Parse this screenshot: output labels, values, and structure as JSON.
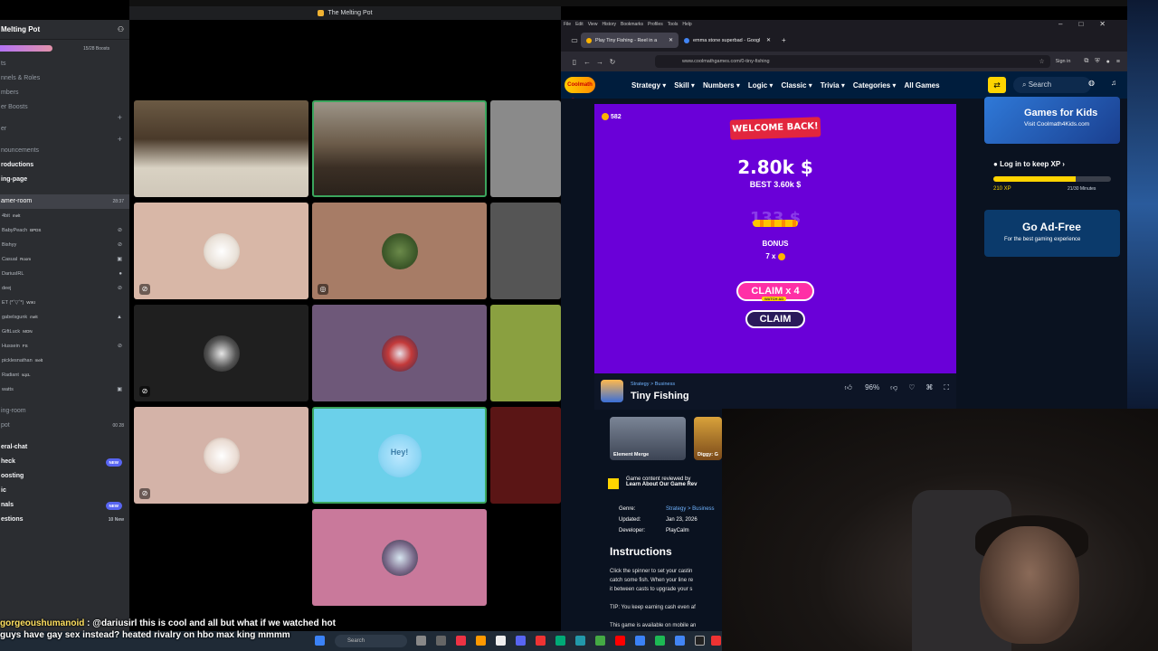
{
  "discord": {
    "server_name": "Melting Pot",
    "boosts": "15/28 Boosts",
    "channels_top": [
      "ts",
      "nnels & Roles",
      "mbers",
      "er Boosts"
    ],
    "text_channels": [
      "er",
      "",
      "nouncements",
      "roductions",
      "ing-page"
    ],
    "voice_channel": "amer-room",
    "voice_time": "28:37",
    "users": [
      {
        "name": "4bit",
        "tag": "melt"
      },
      {
        "name": "BabyPeach",
        "tag": "BPDS"
      },
      {
        "name": "Bishyy",
        "tag": ""
      },
      {
        "name": "Casual",
        "tag": "Room"
      },
      {
        "name": "DariusIRL",
        "tag": ""
      },
      {
        "name": "deej",
        "tag": ""
      },
      {
        "name": "ET (*ˆ▽ˆ*)",
        "tag": "WIKI"
      },
      {
        "name": "gabelsgunk",
        "tag": "melt"
      },
      {
        "name": "GiftLuck",
        "tag": "MON"
      },
      {
        "name": "Hussein",
        "tag": "FS"
      },
      {
        "name": "picklesnathan",
        "tag": "melt"
      },
      {
        "name": "Radiant",
        "tag": "sqcL"
      },
      {
        "name": "watts",
        "tag": ""
      }
    ],
    "bottom_channels": [
      {
        "label": "ing-room",
        "right": ""
      },
      {
        "label": "pot",
        "right": "00 28"
      },
      {
        "label": "eral-chat",
        "right": ""
      },
      {
        "label": "heck",
        "badge": "NEW"
      },
      {
        "label": "oosting",
        "right": ""
      },
      {
        "label": "ic",
        "right": ""
      },
      {
        "label": "nals",
        "badge": "NEW"
      },
      {
        "label": "estions",
        "right": "10 New"
      }
    ]
  },
  "call": {
    "window_title": "The Melting Pot",
    "tile_colors": [
      "#d8b7a7",
      "#a77c66",
      "#1f1f1f",
      "#6e5879",
      "#d4b3a8",
      "#6bd0ea",
      "#c9799b"
    ],
    "hey_text": "Hey!"
  },
  "browser": {
    "menu": [
      "File",
      "Edit",
      "View",
      "History",
      "Bookmarks",
      "Profiles",
      "Tools",
      "Help"
    ],
    "tabs": [
      {
        "title": "Play Tiny Fishing - Reel in a",
        "active": true
      },
      {
        "title": "emma stone superbad - Googl",
        "active": false
      }
    ],
    "url": "www.coolmathgames.com/0-tiny-fishing",
    "signin": "Sign in"
  },
  "coolmath": {
    "logo": "Coolmath Games",
    "nav": [
      "Strategy ▾",
      "Skill ▾",
      "Numbers ▾",
      "Logic ▾",
      "Classic ▾",
      "Trivia ▾",
      "Categories ▾",
      "All Games"
    ],
    "search": "Search",
    "game": {
      "coins": "582",
      "welcome": "WELCOME BACK!",
      "cash": "2.80k $",
      "best": "BEST 3.60k $",
      "bonus_value": "133 $",
      "bonus_label": "BONUS",
      "multiplier": "7 x",
      "claim4": "CLAIM x 4",
      "watch_ad": "WATCH AD",
      "claim": "CLAIM"
    },
    "info": {
      "category": "Strategy > Business",
      "title": "Tiny Fishing",
      "like": "96%"
    },
    "sidebar": {
      "kids_title": "Games for Kids",
      "kids_sub": "Visit Coolmath4Kids.com",
      "xp_title": "Log in to keep XP",
      "xp_value": "210 XP",
      "xp_minutes": "21/30 Minutes",
      "xp_progress": 0.7,
      "adfree_title": "Go Ad-Free",
      "adfree_sub": "For the best gaming experience"
    },
    "related": [
      "Element Merge",
      "Diggy: G"
    ],
    "reviewed_1": "Game content reviewed by",
    "reviewed_2": "Learn About Our Game Rev",
    "meta": [
      {
        "k": "Genre:",
        "v": "Strategy > Business"
      },
      {
        "k": "Updated:",
        "v": "Jan 23, 2026"
      },
      {
        "k": "Developer:",
        "v": "PlayCalm"
      }
    ],
    "instructions_title": "Instructions",
    "instructions": [
      "Click the spinner to set your castin",
      "catch some fish. When your line re",
      "it between casts to upgrade your s",
      "",
      "TIP: You keep earning cash even af",
      "",
      "This game is available on mobile an"
    ]
  },
  "chat": {
    "user": "gorgeoushumanoid",
    "line1": " : @dariusirl this is cool and all but what if we watched hot",
    "line2": "guys have gay sex instead? heated rivalry on hbo max king mmmm"
  },
  "taskbar": {
    "search": "Search"
  }
}
